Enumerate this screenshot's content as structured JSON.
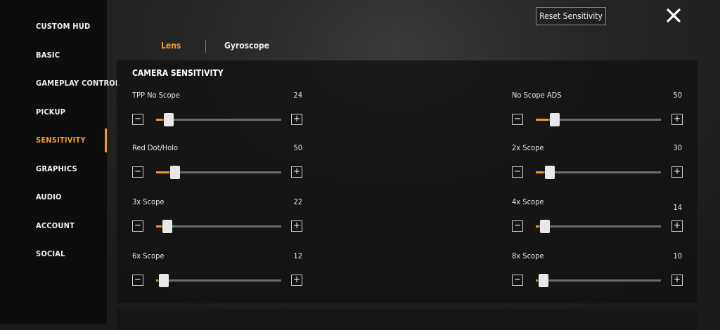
{
  "sidebar": {
    "items": [
      {
        "label": "CUSTOM HUD",
        "active": false
      },
      {
        "label": "BASIC",
        "active": false
      },
      {
        "label": "GAMEPLAY CONTROL",
        "active": false
      },
      {
        "label": "PICKUP",
        "active": false
      },
      {
        "label": "SENSITIVITY",
        "active": true
      },
      {
        "label": "GRAPHICS",
        "active": false
      },
      {
        "label": "AUDIO",
        "active": false
      },
      {
        "label": "ACCOUNT",
        "active": false
      },
      {
        "label": "SOCIAL",
        "active": false
      }
    ]
  },
  "header": {
    "reset_label": "Reset Sensitivity",
    "close_icon": "close-icon"
  },
  "tabs": [
    {
      "label": "Lens",
      "active": true
    },
    {
      "label": "Gyroscope",
      "active": false
    }
  ],
  "section": {
    "title": "CAMERA SENSITIVITY",
    "sliders": [
      {
        "label": "TPP No Scope",
        "value": "24",
        "level": 0.05
      },
      {
        "label": "No Scope ADS",
        "value": "50",
        "level": 0.1
      },
      {
        "label": "Red Dot/Holo",
        "value": "50",
        "level": 0.1
      },
      {
        "label": "2x Scope",
        "value": "30",
        "level": 0.06
      },
      {
        "label": "3x Scope",
        "value": "22",
        "level": 0.04
      },
      {
        "label": "4x Scope",
        "value": "14",
        "level": 0.02
      },
      {
        "label": "6x Scope",
        "value": "12",
        "level": 0.01
      },
      {
        "label": "8x Scope",
        "value": "10",
        "level": 0.01
      }
    ],
    "minus_symbol": "−",
    "plus_symbol": "+"
  },
  "colors": {
    "accent": "#f29b26",
    "track": "#6b6b6b",
    "thumb": "#e8e8e8"
  }
}
